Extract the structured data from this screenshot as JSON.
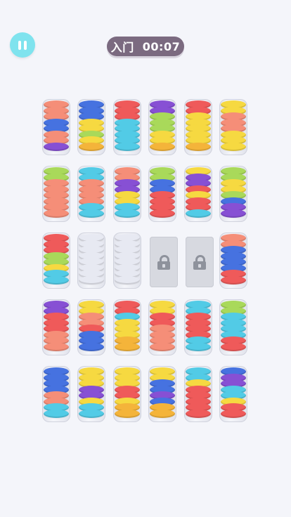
{
  "header": {
    "level_label": "入门",
    "timer": "00:07"
  },
  "colors": {
    "R": "#ef5a5a",
    "S": "#f58e78",
    "B": "#4672e0",
    "C": "#52cbe6",
    "P": "#8750d4",
    "Y": "#f6d941",
    "O": "#f4b43a",
    "G": "#a9d95a",
    "W": "#e7e9f2"
  },
  "board": {
    "rows": [
      [
        {
          "type": "tube",
          "discs": [
            "S",
            "S",
            "S",
            "B",
            "B",
            "S",
            "S",
            "P"
          ]
        },
        {
          "type": "tube",
          "discs": [
            "B",
            "B",
            "B",
            "Y",
            "Y",
            "G",
            "Y",
            "O"
          ]
        },
        {
          "type": "tube",
          "discs": [
            "R",
            "R",
            "R",
            "C",
            "C",
            "C",
            "C",
            "C"
          ]
        },
        {
          "type": "tube",
          "discs": [
            "P",
            "P",
            "G",
            "G",
            "G",
            "Y",
            "Y",
            "O"
          ]
        },
        {
          "type": "tube",
          "discs": [
            "R",
            "R",
            "Y",
            "Y",
            "Y",
            "Y",
            "Y",
            "O"
          ]
        },
        {
          "type": "tube",
          "discs": [
            "Y",
            "Y",
            "S",
            "S",
            "S",
            "Y",
            "Y",
            "Y"
          ]
        }
      ],
      [
        {
          "type": "tube",
          "discs": [
            "G",
            "G",
            "S",
            "S",
            "S",
            "S",
            "S",
            "S"
          ]
        },
        {
          "type": "tube",
          "discs": [
            "C",
            "C",
            "S",
            "S",
            "S",
            "S",
            "C",
            "C"
          ]
        },
        {
          "type": "tube",
          "discs": [
            "S",
            "S",
            "P",
            "P",
            "Y",
            "Y",
            "C",
            "C"
          ]
        },
        {
          "type": "tube",
          "discs": [
            "G",
            "G",
            "B",
            "B",
            "R",
            "R",
            "R",
            "R"
          ]
        },
        {
          "type": "tube",
          "discs": [
            "Y",
            "P",
            "P",
            "R",
            "Y",
            "R",
            "R",
            "C"
          ]
        },
        {
          "type": "tube",
          "discs": [
            "G",
            "G",
            "Y",
            "Y",
            "G",
            "B",
            "P",
            "P"
          ]
        }
      ],
      [
        {
          "type": "tube",
          "discs": [
            "R",
            "R",
            "R",
            "G",
            "G",
            "Y",
            "C",
            "C"
          ]
        },
        {
          "type": "tube",
          "discs": [
            "W",
            "W",
            "W",
            "W",
            "W",
            "W",
            "W",
            "W"
          ]
        },
        {
          "type": "tube",
          "discs": [
            "W",
            "W",
            "W",
            "W",
            "W",
            "W",
            "W",
            "W"
          ]
        },
        {
          "type": "locked"
        },
        {
          "type": "locked"
        },
        {
          "type": "tube",
          "discs": [
            "S",
            "S",
            "B",
            "B",
            "B",
            "B",
            "R",
            "R"
          ]
        }
      ],
      [
        {
          "type": "tube",
          "discs": [
            "P",
            "P",
            "R",
            "R",
            "R",
            "S",
            "S",
            "S"
          ]
        },
        {
          "type": "tube",
          "discs": [
            "Y",
            "Y",
            "S",
            "S",
            "R",
            "B",
            "B",
            "B"
          ]
        },
        {
          "type": "tube",
          "discs": [
            "R",
            "R",
            "C",
            "Y",
            "Y",
            "Y",
            "O",
            "O"
          ]
        },
        {
          "type": "tube",
          "discs": [
            "Y",
            "Y",
            "R",
            "R",
            "S",
            "S",
            "S",
            "S"
          ]
        },
        {
          "type": "tube",
          "discs": [
            "C",
            "C",
            "R",
            "R",
            "R",
            "R",
            "C",
            "C"
          ]
        },
        {
          "type": "tube",
          "discs": [
            "G",
            "G",
            "C",
            "C",
            "C",
            "C",
            "R",
            "R"
          ]
        }
      ],
      [
        {
          "type": "tube",
          "discs": [
            "B",
            "B",
            "B",
            "B",
            "S",
            "S",
            "C",
            "C"
          ]
        },
        {
          "type": "tube",
          "discs": [
            "Y",
            "Y",
            "Y",
            "P",
            "P",
            "Y",
            "C",
            "C"
          ]
        },
        {
          "type": "tube",
          "discs": [
            "Y",
            "Y",
            "Y",
            "R",
            "R",
            "Y",
            "O",
            "O"
          ]
        },
        {
          "type": "tube",
          "discs": [
            "Y",
            "Y",
            "B",
            "B",
            "P",
            "B",
            "O",
            "O"
          ]
        },
        {
          "type": "tube",
          "discs": [
            "C",
            "C",
            "Y",
            "R",
            "R",
            "R",
            "R",
            "R"
          ]
        },
        {
          "type": "tube",
          "discs": [
            "B",
            "P",
            "P",
            "C",
            "C",
            "Y",
            "R",
            "R"
          ]
        }
      ]
    ]
  }
}
